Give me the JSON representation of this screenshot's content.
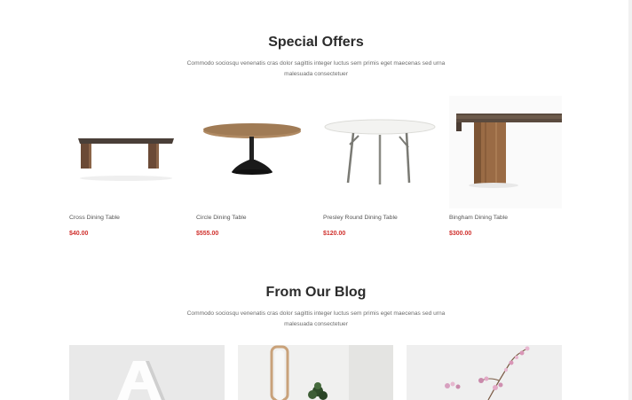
{
  "special_offers": {
    "title": "Special Offers",
    "description": "Commodo sociosqu venenatis cras dolor sagittis integer luctus sem primis eget maecenas sed urna malesuada consectetuer",
    "products": [
      {
        "name": "Cross Dining Table",
        "price": "$40.00",
        "icon": "cross-dining-table-image"
      },
      {
        "name": "Circle Dining Table",
        "price": "$555.00",
        "icon": "circle-dining-table-image"
      },
      {
        "name": "Presley Round Dining Table",
        "price": "$120.00",
        "icon": "presley-round-table-image"
      },
      {
        "name": "Bingham Dining Table",
        "price": "$300.00",
        "icon": "bingham-dining-table-image"
      }
    ]
  },
  "blog": {
    "title": "From Our Blog",
    "description": "Commodo sociosqu venenatis cras dolor sagittis integer luctus sem primis eget maecenas sed urna malesuada consectetuer",
    "posts": [
      {
        "icon": "letter-a-decor-image"
      },
      {
        "icon": "mirror-plant-image"
      },
      {
        "icon": "flower-branch-vase-image"
      }
    ]
  },
  "colors": {
    "price": "#d0312d",
    "title": "#2b2b2b",
    "text": "#6b6b6b"
  }
}
